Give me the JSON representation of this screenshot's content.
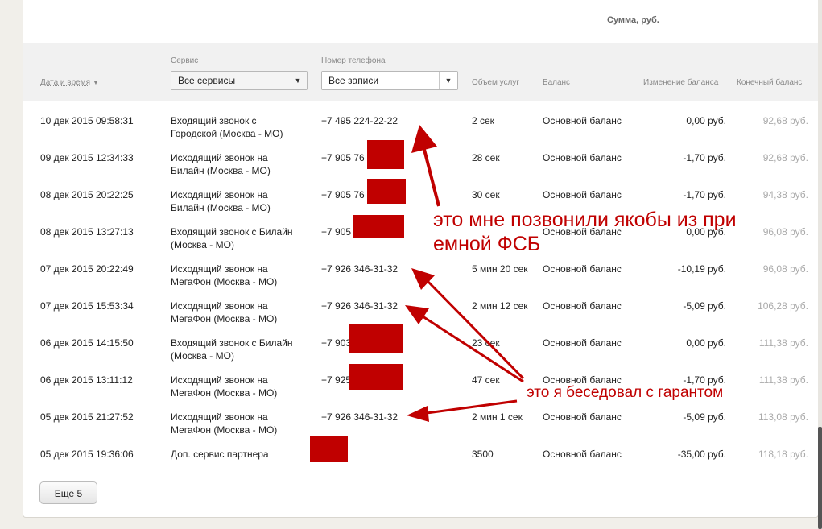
{
  "header": {
    "sum_label": "Сумма, руб."
  },
  "filters": {
    "service_label": "Сервис",
    "service_value": "Все сервисы",
    "phone_label": "Номер телефона",
    "phone_value": "Все записи"
  },
  "columns": {
    "date": "Дата и время",
    "volume": "Объем услуг",
    "balance": "Баланс",
    "change": "Изменение баланса",
    "final": "Конечный баланс"
  },
  "rows": [
    {
      "date": "10 дек 2015 09:58:31",
      "service1": "Входящий звонок с",
      "service2": "Городской (Москва - МО)",
      "phone": "+7 495 224-22-22",
      "volume": "2 сек",
      "balance": "Основной баланс",
      "change": "0,00 руб.",
      "final": "92,68 руб."
    },
    {
      "date": "09 дек 2015 12:34:33",
      "service1": "Исходящий звонок на",
      "service2": "Билайн (Москва - МО)",
      "phone": "+7 905 76",
      "volume": "28 сек",
      "balance": "Основной баланс",
      "change": "-1,70 руб.",
      "final": "92,68 руб."
    },
    {
      "date": "08 дек 2015 20:22:25",
      "service1": "Исходящий звонок на",
      "service2": "Билайн (Москва - МО)",
      "phone": "+7 905 76",
      "volume": "30 сек",
      "balance": "Основной баланс",
      "change": "-1,70 руб.",
      "final": "94,38 руб."
    },
    {
      "date": "08 дек 2015 13:27:13",
      "service1": "Входящий звонок с Билайн",
      "service2": "(Москва - МО)",
      "phone": "+7 905",
      "volume": "",
      "balance": "Основной баланс",
      "change": "0,00 руб.",
      "final": "96,08 руб."
    },
    {
      "date": "07 дек 2015 20:22:49",
      "service1": "Исходящий звонок на",
      "service2": "МегаФон (Москва - МО)",
      "phone": "+7 926 346-31-32",
      "volume": "5 мин 20 сек",
      "balance": "Основной баланс",
      "change": "-10,19 руб.",
      "final": "96,08 руб."
    },
    {
      "date": "07 дек 2015 15:53:34",
      "service1": "Исходящий звонок на",
      "service2": "МегаФон (Москва - МО)",
      "phone": "+7 926 346-31-32",
      "volume": "2 мин 12 сек",
      "balance": "Основной баланс",
      "change": "-5,09 руб.",
      "final": "106,28 руб."
    },
    {
      "date": "06 дек 2015 14:15:50",
      "service1": "Входящий звонок с Билайн",
      "service2": "(Москва - МО)",
      "phone": "+7 903",
      "volume": "23 сек",
      "balance": "Основной баланс",
      "change": "0,00 руб.",
      "final": "111,38 руб."
    },
    {
      "date": "06 дек 2015 13:11:12",
      "service1": "Исходящий звонок на",
      "service2": "МегаФон (Москва - МО)",
      "phone": "+7 925",
      "volume": "47 сек",
      "balance": "Основной баланс",
      "change": "-1,70 руб.",
      "final": "111,38 руб."
    },
    {
      "date": "05 дек 2015 21:27:52",
      "service1": "Исходящий звонок на",
      "service2": "МегаФон (Москва - МО)",
      "phone": "+7 926 346-31-32",
      "volume": "2 мин 1 сек",
      "balance": "Основной баланс",
      "change": "-5,09 руб.",
      "final": "113,08 руб."
    },
    {
      "date": "05 дек 2015 19:36:06",
      "service1": "Доп. сервис партнера",
      "service2": "",
      "phone": "",
      "volume": "3500",
      "balance": "Основной баланс",
      "change": "-35,00 руб.",
      "final": "118,18 руб."
    }
  ],
  "more_button": "Еще 5",
  "annotations": {
    "note1_line1": "это мне позвонили якобы из при",
    "note1_line2": "емной ФСБ",
    "note2": "это я беседовал с гарантом"
  },
  "colors": {
    "annotation": "#c00000",
    "accent": "#e5a24a"
  }
}
